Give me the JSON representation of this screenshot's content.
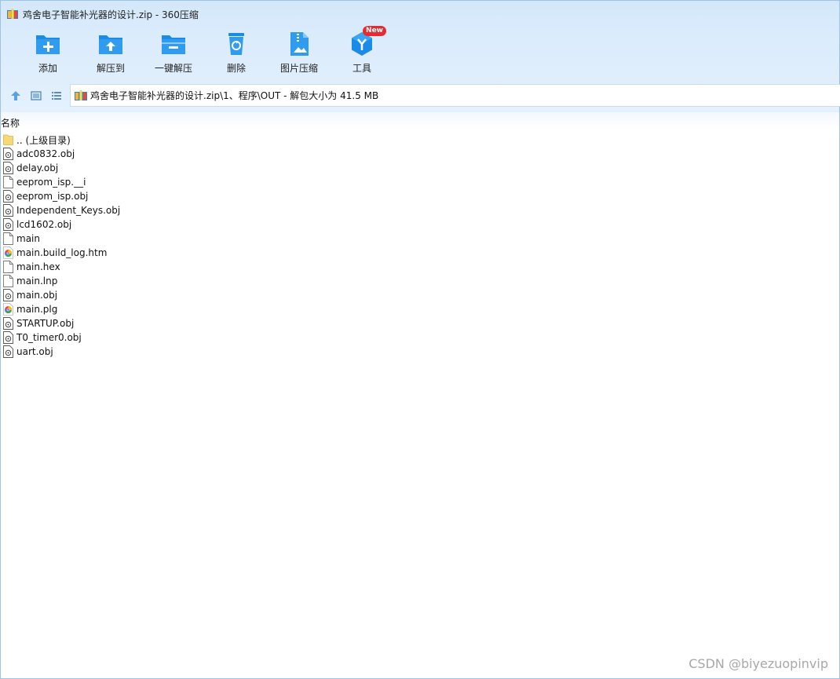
{
  "window": {
    "title": "鸡舍电子智能补光器的设计.zip - 360压缩"
  },
  "toolbar": {
    "items": [
      {
        "label": "添加",
        "icon": "add-icon"
      },
      {
        "label": "解压到",
        "icon": "extract-to-icon"
      },
      {
        "label": "一键解压",
        "icon": "one-click-extract-icon"
      },
      {
        "label": "删除",
        "icon": "delete-icon"
      },
      {
        "label": "图片压缩",
        "icon": "image-compress-icon"
      },
      {
        "label": "工具",
        "icon": "tools-icon",
        "badge": "New"
      }
    ]
  },
  "nav": {
    "path": "鸡舍电子智能补光器的设计.zip\\1、程序\\OUT - 解包大小为 41.5 MB"
  },
  "list": {
    "column_name": "名称",
    "files": [
      {
        "name": ".. (上级目录)",
        "icon": "folder-icon"
      },
      {
        "name": "adc0832.obj",
        "icon": "obj-file-icon"
      },
      {
        "name": "delay.obj",
        "icon": "obj-file-icon"
      },
      {
        "name": "eeprom_isp.__i",
        "icon": "blank-file-icon"
      },
      {
        "name": "eeprom_isp.obj",
        "icon": "obj-file-icon"
      },
      {
        "name": "Independent_Keys.obj",
        "icon": "obj-file-icon"
      },
      {
        "name": "lcd1602.obj",
        "icon": "obj-file-icon"
      },
      {
        "name": "main",
        "icon": "blank-file-icon"
      },
      {
        "name": "main.build_log.htm",
        "icon": "browser-file-icon"
      },
      {
        "name": "main.hex",
        "icon": "blank-file-icon"
      },
      {
        "name": "main.lnp",
        "icon": "blank-file-icon"
      },
      {
        "name": "main.obj",
        "icon": "obj-file-icon"
      },
      {
        "name": "main.plg",
        "icon": "browser-file-icon"
      },
      {
        "name": "STARTUP.obj",
        "icon": "obj-file-icon"
      },
      {
        "name": "T0_timer0.obj",
        "icon": "obj-file-icon"
      },
      {
        "name": "uart.obj",
        "icon": "obj-file-icon"
      }
    ]
  },
  "watermark": "CSDN @biyezuopinvip",
  "colors": {
    "accent": "#1a8ce8",
    "toolbar_bg": "#d9ebfc",
    "badge": "#e8292f"
  }
}
